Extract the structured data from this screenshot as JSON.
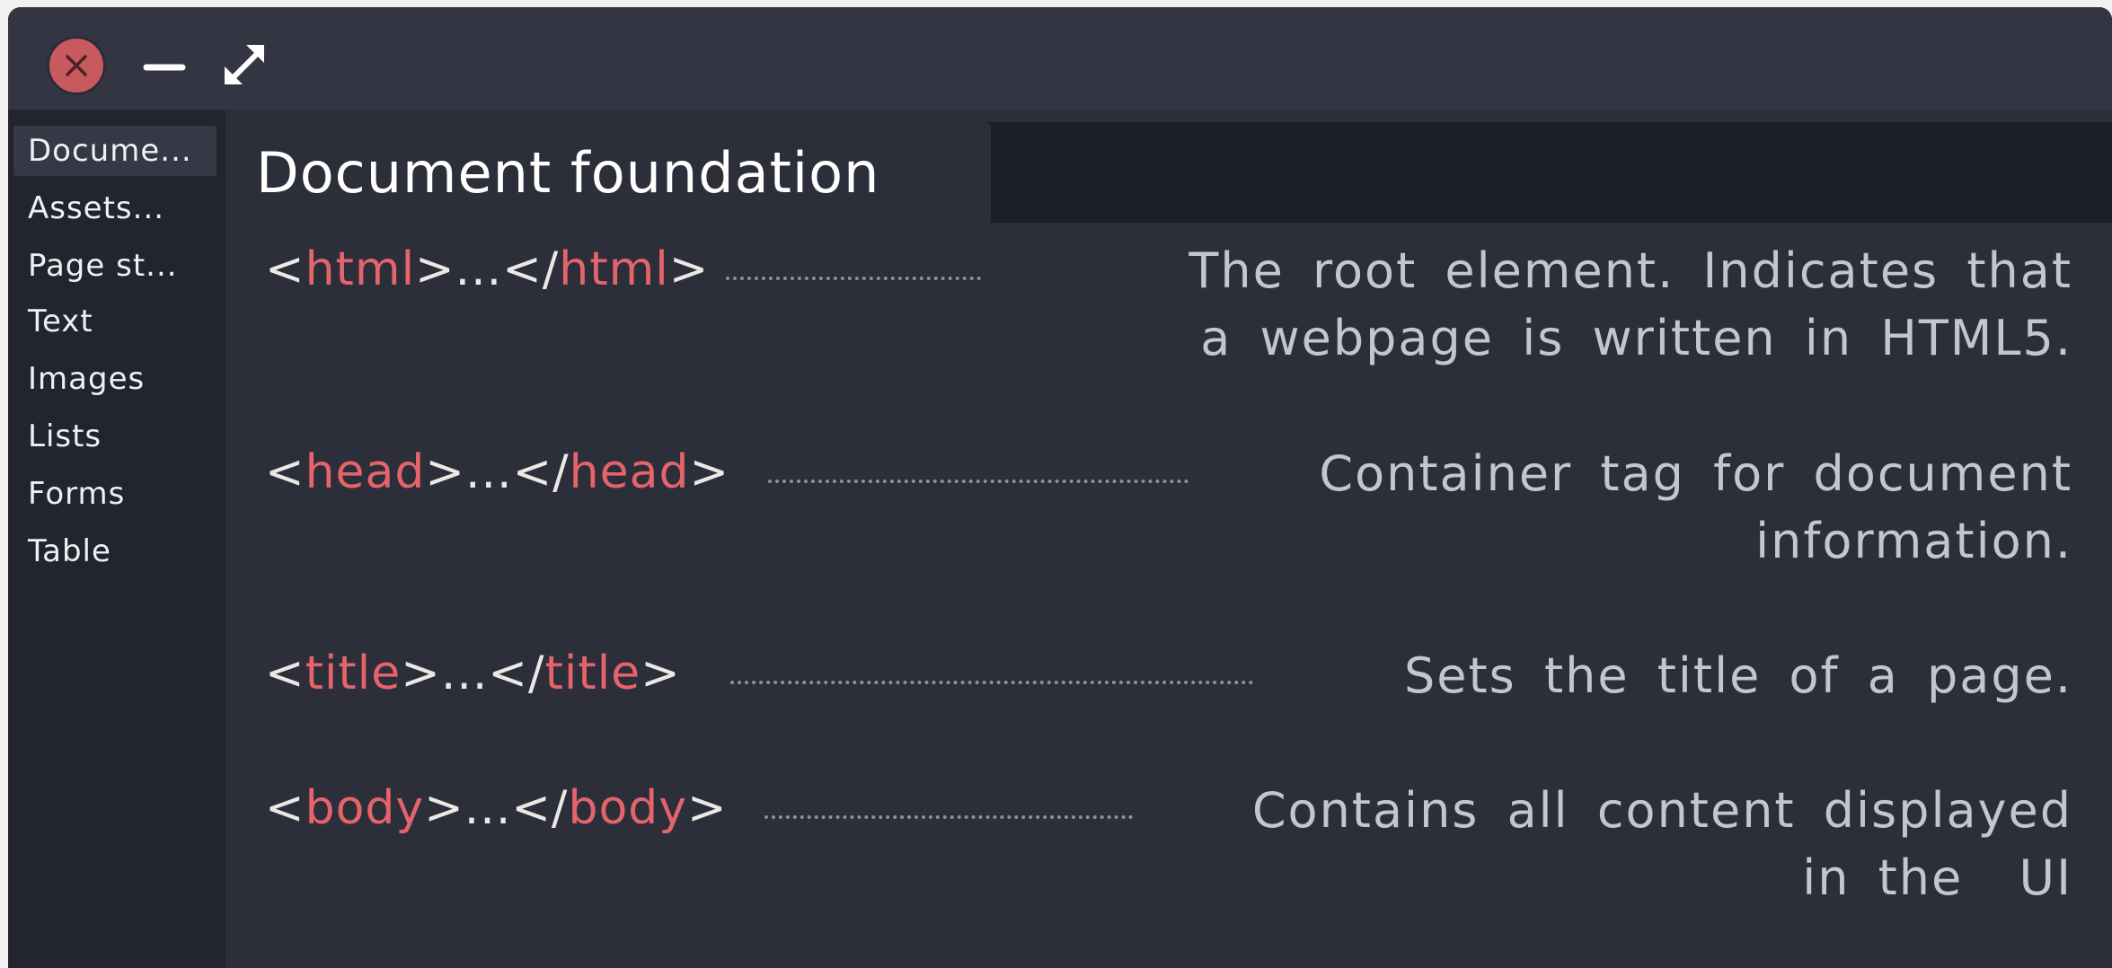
{
  "window": {
    "controls": {
      "close_icon": "close-icon",
      "minimize_icon": "minimize-icon",
      "maximize_icon": "maximize-icon",
      "close_color": "#c85a5f"
    }
  },
  "sidebar": {
    "items": [
      {
        "label": "Docume...",
        "active": true
      },
      {
        "label": "Assets...",
        "active": false
      },
      {
        "label": "Page st...",
        "active": false
      },
      {
        "label": "Text",
        "active": false
      },
      {
        "label": "Images",
        "active": false
      },
      {
        "label": "Lists",
        "active": false
      },
      {
        "label": "Forms",
        "active": false
      },
      {
        "label": "Table",
        "active": false
      }
    ]
  },
  "main": {
    "title": "Document foundation",
    "entries": [
      {
        "open": "<",
        "name_open": "html",
        "mid": ">...</",
        "name_close": "html",
        "close": ">",
        "desc_line1": "The root element. Indicates that",
        "desc_line2": "a webpage is written in HTML5."
      },
      {
        "open": "<",
        "name_open": "head",
        "mid": ">...</",
        "name_close": "head",
        "close": ">",
        "desc_line1": "Container tag for document",
        "desc_line2": "information."
      },
      {
        "open": "<",
        "name_open": "title",
        "mid": ">...</",
        "name_close": "title",
        "close": ">",
        "desc_line1": "Sets the title of a page.",
        "desc_line2": ""
      },
      {
        "open": "<",
        "name_open": "body",
        "mid": ">...</",
        "name_close": "body",
        "close": ">",
        "desc_line1": "Contains all content displayed",
        "desc_line2": "in the  UI"
      }
    ]
  },
  "colors": {
    "tag_name": "#e5646c",
    "tag_bracket": "#ece8e6",
    "description": "#c4c6ce",
    "background": "#2c2f3a",
    "titlebar": "#343543",
    "sidebar": "#22252d"
  }
}
